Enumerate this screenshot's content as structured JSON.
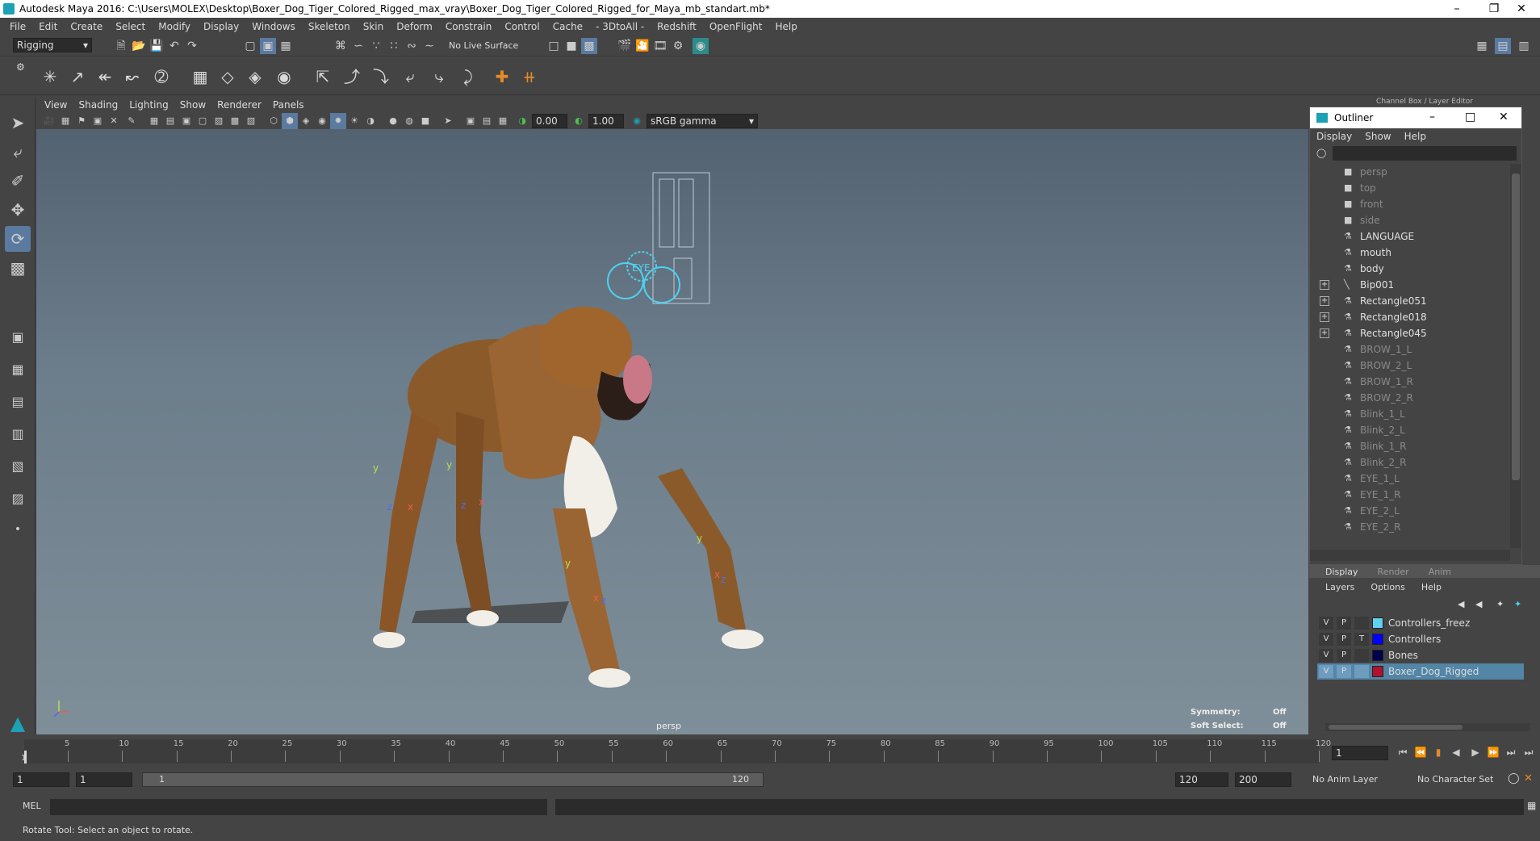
{
  "window": {
    "title": "Autodesk Maya 2016: C:\\Users\\MOLEX\\Desktop\\Boxer_Dog_Tiger_Colored_Rigged_max_vray\\Boxer_Dog_Tiger_Colored_Rigged_for_Maya_mb_standart.mb*"
  },
  "menubar": [
    "File",
    "Edit",
    "Create",
    "Select",
    "Modify",
    "Display",
    "Windows",
    "Skeleton",
    "Skin",
    "Deform",
    "Constrain",
    "Control",
    "Cache",
    "- 3DtoAll -",
    "Redshift",
    "OpenFlight",
    "Help"
  ],
  "toolbar": {
    "mode": "Rigging",
    "live_surface": "No Live Surface"
  },
  "viewport": {
    "menu": [
      "View",
      "Shading",
      "Lighting",
      "Show",
      "Renderer",
      "Panels"
    ],
    "field_a": "0.00",
    "field_b": "1.00",
    "color_space": "sRGB gamma",
    "camera_label": "persp",
    "symmetry_label": "Symmetry:",
    "symmetry_value": "Off",
    "soft_select_label": "Soft Select:",
    "soft_select_value": "Off"
  },
  "outliner": {
    "title": "Outliner",
    "menu": [
      "Display",
      "Show",
      "Help"
    ],
    "items": [
      {
        "label": "persp",
        "dim": true,
        "expand": false,
        "icon": "camera-icon"
      },
      {
        "label": "top",
        "dim": true,
        "expand": false,
        "icon": "camera-icon"
      },
      {
        "label": "front",
        "dim": true,
        "expand": false,
        "icon": "camera-icon"
      },
      {
        "label": "side",
        "dim": true,
        "expand": false,
        "icon": "camera-icon"
      },
      {
        "label": "LANGUAGE",
        "dim": false,
        "expand": false,
        "icon": "mesh-icon"
      },
      {
        "label": "mouth",
        "dim": false,
        "expand": false,
        "icon": "mesh-icon"
      },
      {
        "label": "body",
        "dim": false,
        "expand": false,
        "icon": "mesh-icon"
      },
      {
        "label": "Bip001",
        "dim": false,
        "expand": true,
        "icon": "joint-icon"
      },
      {
        "label": "Rectangle051",
        "dim": false,
        "expand": true,
        "icon": "mesh-icon"
      },
      {
        "label": "Rectangle018",
        "dim": false,
        "expand": true,
        "icon": "mesh-icon"
      },
      {
        "label": "Rectangle045",
        "dim": false,
        "expand": true,
        "icon": "mesh-icon"
      },
      {
        "label": "BROW_1_L",
        "dim": true,
        "expand": false,
        "icon": "mesh-icon"
      },
      {
        "label": "BROW_2_L",
        "dim": true,
        "expand": false,
        "icon": "mesh-icon"
      },
      {
        "label": "BROW_1_R",
        "dim": true,
        "expand": false,
        "icon": "mesh-icon"
      },
      {
        "label": "BROW_2_R",
        "dim": true,
        "expand": false,
        "icon": "mesh-icon"
      },
      {
        "label": "Blink_1_L",
        "dim": true,
        "expand": false,
        "icon": "mesh-icon"
      },
      {
        "label": "Blink_2_L",
        "dim": true,
        "expand": false,
        "icon": "mesh-icon"
      },
      {
        "label": "Blink_1_R",
        "dim": true,
        "expand": false,
        "icon": "mesh-icon"
      },
      {
        "label": "Blink_2_R",
        "dim": true,
        "expand": false,
        "icon": "mesh-icon"
      },
      {
        "label": "EYE_1_L",
        "dim": true,
        "expand": false,
        "icon": "mesh-icon"
      },
      {
        "label": "EYE_1_R",
        "dim": true,
        "expand": false,
        "icon": "mesh-icon"
      },
      {
        "label": "EYE_2_L",
        "dim": true,
        "expand": false,
        "icon": "mesh-icon"
      },
      {
        "label": "EYE_2_R",
        "dim": true,
        "expand": false,
        "icon": "mesh-icon"
      }
    ]
  },
  "channel_box": {
    "header": "Channel Box / Layer Editor",
    "tabs": [
      "Display",
      "Render",
      "Anim"
    ],
    "menu": [
      "Layers",
      "Options",
      "Help"
    ],
    "layers": [
      {
        "v": "V",
        "p": "P",
        "t": "",
        "color": "#5fd3ef",
        "name": "Controllers_freez",
        "selected": false
      },
      {
        "v": "V",
        "p": "P",
        "t": "T",
        "color": "#0000ff",
        "name": "Controllers",
        "selected": false
      },
      {
        "v": "V",
        "p": "P",
        "t": "",
        "color": "#00004d",
        "name": "Bones",
        "selected": false
      },
      {
        "v": "V",
        "p": "P",
        "t": "",
        "color": "#b0112e",
        "name": "Boxer_Dog_Rigged",
        "selected": true
      }
    ]
  },
  "timeline": {
    "ticks": [
      "5",
      "10",
      "15",
      "20",
      "25",
      "30",
      "35",
      "40",
      "45",
      "50",
      "55",
      "60",
      "65",
      "70",
      "75",
      "80",
      "85",
      "90",
      "95",
      "100",
      "105",
      "110",
      "115",
      "120"
    ],
    "start_marker": "1",
    "current_frame": "1"
  },
  "range": {
    "start_a": "1",
    "start_b": "1",
    "slider_start": "1",
    "slider_end": "120",
    "end_a": "120",
    "end_b": "200",
    "anim_layer": "No Anim Layer",
    "char_set": "No Character Set"
  },
  "cmdline": {
    "label": "MEL"
  },
  "help": {
    "text": "Rotate Tool: Select an object to rotate."
  },
  "rig": {
    "eye_label": "EYE",
    "axes": {
      "x": "x",
      "y": "y",
      "z": "z"
    }
  }
}
